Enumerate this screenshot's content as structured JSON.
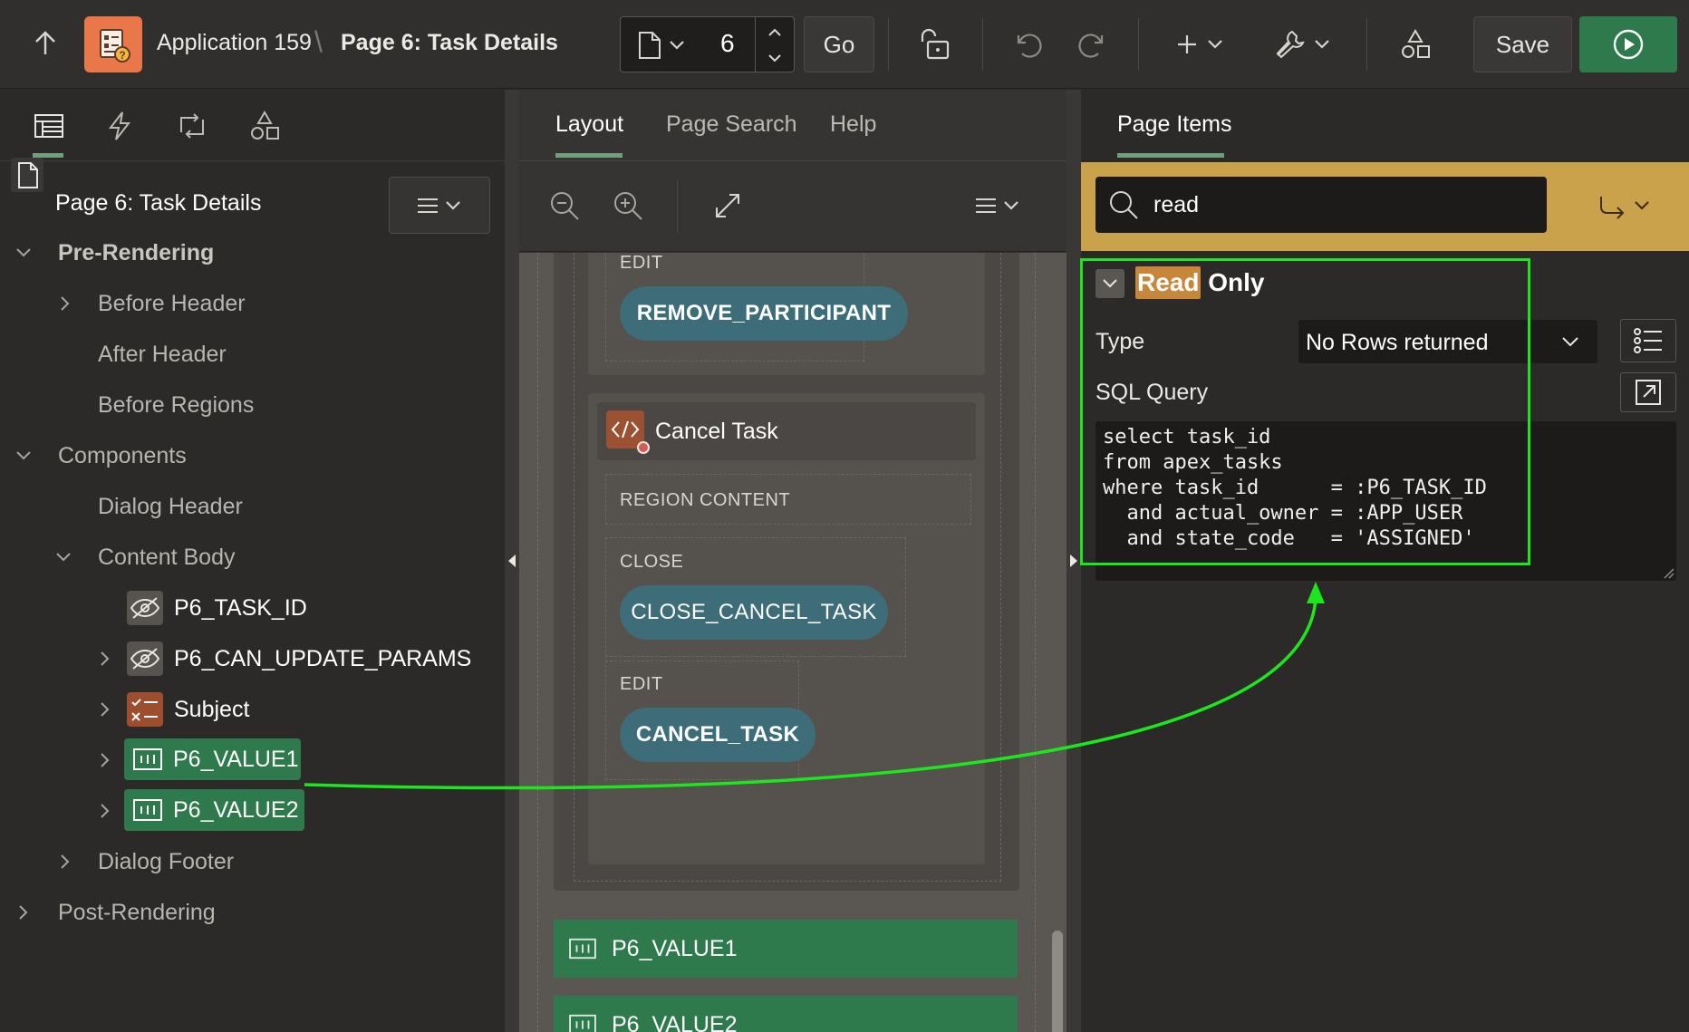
{
  "topbar": {
    "app_name": "Application 159",
    "separator": "\\",
    "page_name": "Page 6: Task Details",
    "page_number": "6",
    "go_label": "Go",
    "save_label": "Save"
  },
  "left": {
    "header": "Page 6: Task Details",
    "tree": {
      "pre_rendering": "Pre-Rendering",
      "before_header": "Before Header",
      "after_header": "After Header",
      "before_regions": "Before Regions",
      "components": "Components",
      "dialog_header": "Dialog Header",
      "content_body": "Content Body",
      "p6_task_id": "P6_TASK_ID",
      "p6_can_update": "P6_CAN_UPDATE_PARAMS",
      "subject": "Subject",
      "p6_value1": "P6_VALUE1",
      "p6_value2": "P6_VALUE2",
      "dialog_footer": "Dialog Footer",
      "post_rendering": "Post-Rendering"
    }
  },
  "middle": {
    "tabs": [
      "Layout",
      "Page Search",
      "Help"
    ],
    "canvas": {
      "edit1": "EDIT",
      "remove_participant": "REMOVE_PARTICIPANT",
      "cancel_task": "Cancel Task",
      "region_content": "REGION CONTENT",
      "close": "CLOSE",
      "close_cancel_task": "CLOSE_CANCEL_TASK",
      "edit2": "EDIT",
      "cancel_task_btn": "CANCEL_TASK",
      "p6_value1": "P6_VALUE1",
      "p6_value2": "P6_VALUE2"
    }
  },
  "right": {
    "tab": "Page Items",
    "search_value": "read",
    "group_title_highlight": "Read",
    "group_title_rest": " Only",
    "type_label": "Type",
    "type_value": "No Rows returned",
    "sql_label": "SQL Query",
    "sql": "select task_id\nfrom apex_tasks\nwhere task_id      = :P6_TASK_ID\n  and actual_owner = :APP_USER\n  and state_code   = 'ASSIGNED'"
  },
  "colors": {
    "accent_green": "#2f7a4d",
    "search_bar": "#c9a24b",
    "annotation": "#1ee61e",
    "highlight": "#c8863a"
  }
}
